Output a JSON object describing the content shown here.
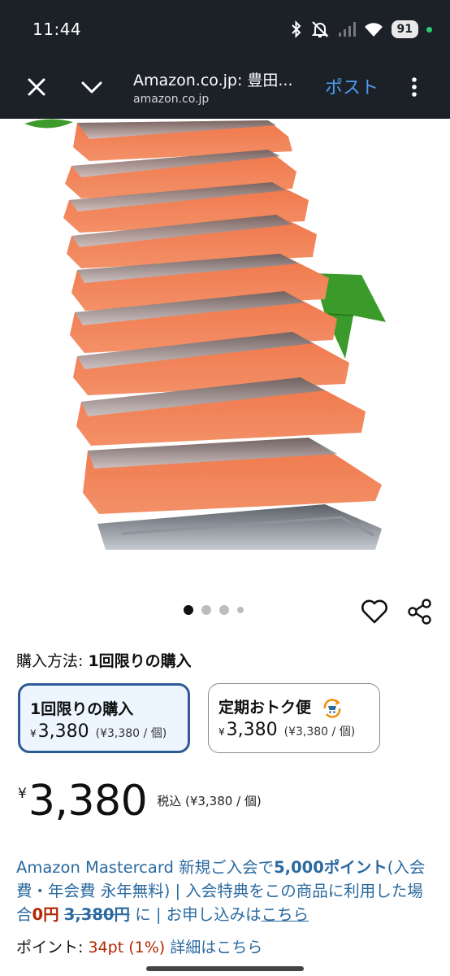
{
  "status_bar": {
    "time": "11:44",
    "battery": "91",
    "icons": [
      "bluetooth-icon",
      "mute-icon",
      "signal-icon",
      "wifi-icon",
      "battery-icon"
    ]
  },
  "tab_bar": {
    "title": "Amazon.co.jp: 豊田...",
    "url": "amazon.co.jp",
    "post_label": "ポスト",
    "icons": [
      "close-icon",
      "chevron-down-icon",
      "more-vertical-icon"
    ]
  },
  "product": {
    "image_description_icon": "salmon-slices-image",
    "carousel_count": 4
  },
  "purchase": {
    "method_label": "購入方法:",
    "method_value": "1回限りの購入",
    "options": [
      {
        "title": "1回限りの購入",
        "yen": "¥",
        "price": "3,380",
        "unit": "(¥3,380 / 個)"
      },
      {
        "title": "定期おトク便",
        "yen": "¥",
        "price": "3,380",
        "unit": "(¥3,380 / 個)"
      }
    ]
  },
  "price": {
    "yen": "¥",
    "amount": "3,380",
    "tax_note": "税込 (¥3,380 / 個)"
  },
  "promo": {
    "part1": "Amazon Mastercard 新規ご入会で",
    "points": "5,000ポイント",
    "part2": "(入会費・年会費 永年無料) | 入会特典をこの商品に利用した場合",
    "zero": "0円",
    "original": "3,380円",
    "part3": "に | お申し込みは",
    "link": "こちら"
  },
  "points": {
    "label": "ポイント:",
    "value": "34pt",
    "percent": "(1%)",
    "detail": "詳細はこちら"
  },
  "colors": {
    "bar_bg": "#1c2128",
    "accent_blue": "#2e5b96",
    "link_blue": "#2b6aa0",
    "price_red": "#b12704",
    "post_blue": "#4b9cf0"
  }
}
